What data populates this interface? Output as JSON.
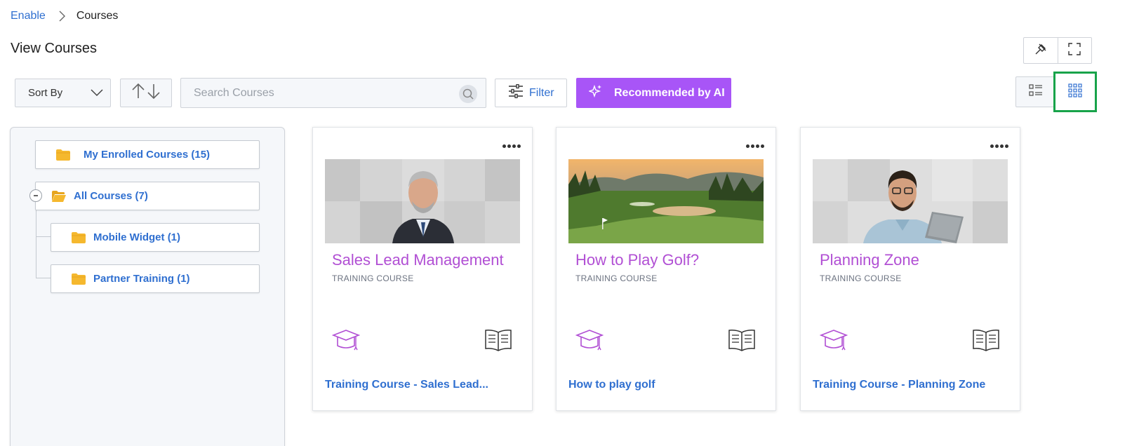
{
  "breadcrumb": {
    "root": "Enable",
    "current": "Courses"
  },
  "page": {
    "title": "View Courses"
  },
  "toolbar": {
    "sort_label": "Sort By",
    "search_placeholder": "Search Courses",
    "filter_label": "Filter",
    "ai_label": "Recommended by AI"
  },
  "view": {
    "active": "grid"
  },
  "sidebar": {
    "enrolled": "My Enrolled Courses (15)",
    "all": "All Courses (7)",
    "children": [
      "Mobile Widget (1)",
      "Partner Training (1)"
    ]
  },
  "cards": [
    {
      "title": "Sales Lead Management",
      "type": "TRAINING COURSE",
      "link": "Training Course - Sales Lead..."
    },
    {
      "title": "How to Play Golf?",
      "type": "TRAINING COURSE",
      "link": "How to play golf"
    },
    {
      "title": "Planning Zone",
      "type": "TRAINING COURSE",
      "link": "Training Course - Planning Zone"
    }
  ],
  "colors": {
    "link": "#2f6fd0",
    "accent_purple": "#a855f7",
    "card_title": "#b14fd4",
    "folder": "#f5b82e",
    "active_outline": "#18a34a"
  },
  "icons": [
    "chevron-right-icon",
    "pin-icon",
    "fullscreen-icon",
    "chevron-down-icon",
    "sort-arrows-icon",
    "search-icon",
    "filter-sliders-icon",
    "sparkle-icon",
    "list-view-icon",
    "grid-view-icon",
    "folder-icon",
    "more-dots-icon",
    "graduation-cap-icon",
    "book-icon"
  ]
}
